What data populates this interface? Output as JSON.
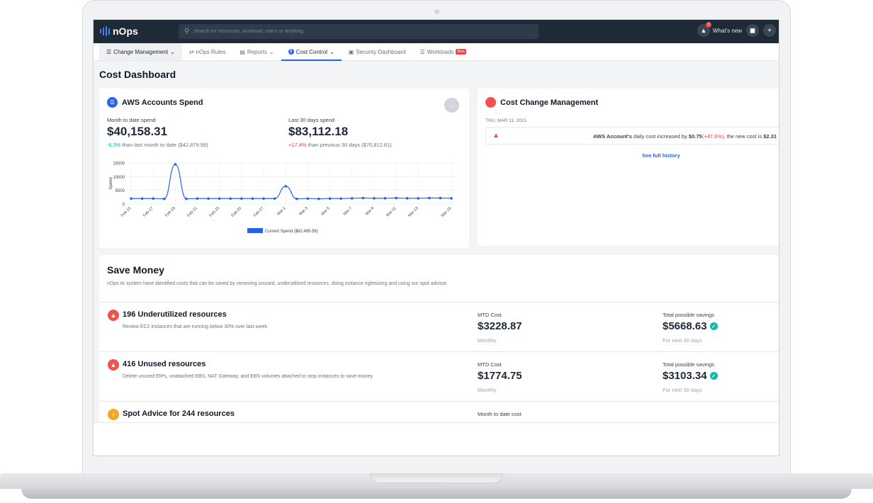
{
  "topbar": {
    "logo_text": "nOps",
    "search_placeholder": "Search for resources, workload, users or anything.",
    "notification_count": "3",
    "whats_new": "What's new"
  },
  "nav": {
    "items": [
      {
        "label": "Change Management"
      },
      {
        "label": "nOps Rules"
      },
      {
        "label": "Reports"
      },
      {
        "label": "Cost Control"
      },
      {
        "label": "Security Dashboard"
      },
      {
        "label": "Workloads"
      }
    ],
    "beta_label": "Beta"
  },
  "page": {
    "title": "Cost Dashboard"
  },
  "aws_spend": {
    "title": "AWS Accounts Spend",
    "mtd_label": "Month to date spend",
    "mtd_value": "$40,158.31",
    "mtd_change": "-6.3%",
    "mtd_note": " than last month to date ($42,879.99)",
    "last30_label": "Last 30 days spend",
    "last30_value": "$83,112.18",
    "last30_change": "+17.4%",
    "last30_note": " than previous 30 days ($70,812.81)"
  },
  "chart_data": {
    "type": "line",
    "ylabel": "Spend",
    "ylim": [
      0,
      15000
    ],
    "yticks": [
      "0",
      "5000",
      "10000",
      "15000"
    ],
    "x": [
      "Feb-15",
      "Feb-16",
      "Feb-17",
      "Feb-18",
      "Feb-19",
      "Feb-20",
      "Feb-21",
      "Feb-22",
      "Feb-23",
      "Feb-24",
      "Feb-25",
      "Feb-26",
      "Feb-27",
      "Feb-28",
      "Mar-1",
      "Mar-2",
      "Mar-3",
      "Mar-4",
      "Mar-5",
      "Mar-6",
      "Mar-7",
      "Mar-8",
      "Mar-9",
      "Mar-10",
      "Mar-11",
      "Mar-12",
      "Mar-13",
      "Mar-14",
      "Mar-15",
      "Mar-16"
    ],
    "xtick_labels": [
      "Feb-15",
      "Feb-17",
      "Feb-19",
      "Feb-21",
      "Feb-23",
      "Feb-25",
      "Feb-27",
      "Mar-1",
      "Mar-3",
      "Mar-5",
      "Mar-7",
      "Mar-9",
      "Mar-11",
      "Mar-13",
      "Mar-16"
    ],
    "series": [
      {
        "name": "Current Spend ($82,485.56)",
        "values": [
          2000,
          2000,
          2000,
          1900,
          14500,
          1900,
          2000,
          2000,
          2000,
          2000,
          2000,
          2000,
          2000,
          2000,
          6500,
          1900,
          2000,
          1900,
          2000,
          2000,
          2100,
          2200,
          2100,
          2100,
          2200,
          2100,
          2100,
          2200,
          2200,
          2100
        ]
      }
    ],
    "grid": true,
    "legend": "bottom",
    "color": "#2563eb"
  },
  "ccm": {
    "title": "Cost Change Management",
    "date": "THU, MAR 11, 2021",
    "alert_account": "AWS Account's",
    "alert_text1": " daily cost increased by ",
    "alert_increase": "$0.75",
    "alert_pct": "(+47.6%)",
    "alert_text2": ", the new cost is ",
    "alert_new_cost": "$2.31",
    "link": "See full history"
  },
  "save_money": {
    "title": "Save Money",
    "subtitle": "nOps AI system have identified costs that can be saved by removing unused, underutilized resources, doing instance rightsizing and using our spot advisor.",
    "rows": [
      {
        "title": "196 Underutilized resources",
        "desc": "Review EC2 instances that are running below 30% over last week.",
        "cost_label": "MTD Cost",
        "cost_value": "$3228.87",
        "cost_sub": "Monthly",
        "savings_label": "Total possible savings",
        "savings_value": "$5668.63",
        "savings_sub": "For next 30 days"
      },
      {
        "title": "416 Unused resources",
        "desc": "Delete unused EIPs, unattached EBS, NAT Gateway, and EBS volumes attached to stop instances to save money.",
        "cost_label": "MTD Cost",
        "cost_value": "$1774.75",
        "cost_sub": "Monthly",
        "savings_label": "Total possible savings",
        "savings_value": "$3103.34",
        "savings_sub": "For next 30 days"
      },
      {
        "title": "Spot Advice for 244 resources",
        "cost_label": "Month to date cost"
      }
    ]
  }
}
